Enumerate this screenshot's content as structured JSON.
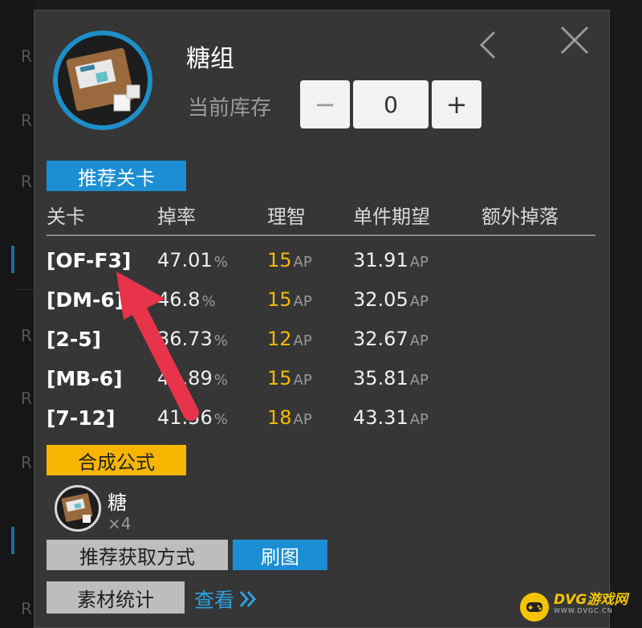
{
  "item": {
    "name": "糖组",
    "stock_label": "当前库存",
    "stock_value": "0",
    "minus_label": "−",
    "plus_label": "+"
  },
  "recommended": {
    "tag": "推荐关卡",
    "headers": [
      "关卡",
      "掉率",
      "理智",
      "单件期望",
      "额外掉落"
    ],
    "ap_unit": "AP",
    "pct_unit": "%",
    "rows": [
      {
        "stage": "[OF-F3]",
        "rate": "47.01",
        "ap": "15",
        "expect": "31.91"
      },
      {
        "stage": "[DM-6]",
        "rate": "46.8",
        "ap": "15",
        "expect": "32.05"
      },
      {
        "stage": "[2-5]",
        "rate": "36.73",
        "ap": "12",
        "expect": "32.67"
      },
      {
        "stage": "[MB-6]",
        "rate": "41.89",
        "ap": "15",
        "expect": "35.81"
      },
      {
        "stage": "[7-12]",
        "rate": "41.56",
        "ap": "18",
        "expect": "43.31"
      }
    ]
  },
  "formula": {
    "tag": "合成公式",
    "material_name": "糖",
    "material_count": "4",
    "count_prefix": "×"
  },
  "actions": {
    "recommend_label": "推荐获取方式",
    "refresh_label": "刷图",
    "stats_label": "素材统计",
    "view_label": "查看"
  },
  "background": {
    "r_letter": "R"
  },
  "watermark": {
    "title": "DVG游戏网",
    "sub": "WWW.DVGC.CN"
  },
  "colors": {
    "panel": "#363636",
    "accent_blue": "#1c8ed4",
    "accent_yellow": "#f7b500",
    "ap_color": "#f5b800",
    "arrow_red": "#e8344a"
  }
}
